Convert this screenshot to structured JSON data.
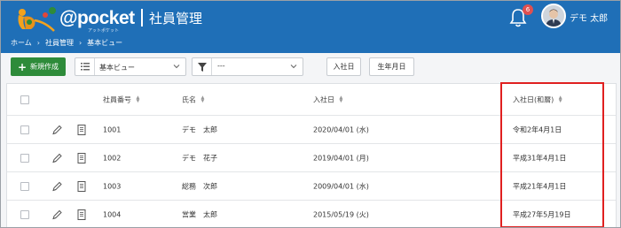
{
  "header": {
    "logo_text": "@pocket",
    "logo_sub": "アットポケット",
    "app_title": "社員管理",
    "breadcrumb": [
      "ホーム",
      "社員管理",
      "基本ビュー"
    ],
    "notification_count": "6",
    "user_name": "デモ 太郎"
  },
  "toolbar": {
    "new_button": "新規作成",
    "view_select": "基本ビュー",
    "filter_select": "---",
    "sort_buttons": [
      "入社日",
      "生年月日"
    ]
  },
  "table": {
    "columns": [
      "社員番号",
      "氏名",
      "入社日",
      "入社日(和暦)"
    ],
    "rows": [
      {
        "id": "1001",
        "name": "デモ　太郎",
        "hire_date": "2020/04/01 (水)",
        "hire_date_jp": "令和2年4月1日"
      },
      {
        "id": "1002",
        "name": "デモ　花子",
        "hire_date": "2019/04/01 (月)",
        "hire_date_jp": "平成31年4月1日"
      },
      {
        "id": "1003",
        "name": "総務　次郎",
        "hire_date": "2009/04/01 (水)",
        "hire_date_jp": "平成21年4月1日"
      },
      {
        "id": "1004",
        "name": "営業　太郎",
        "hire_date": "2015/05/19 (火)",
        "hire_date_jp": "平成27年5月19日"
      }
    ]
  },
  "colors": {
    "header_bg": "#1f6fb7",
    "new_button_bg": "#2e8b3a",
    "highlight_border": "#e02020",
    "badge_bg": "#e05050"
  }
}
